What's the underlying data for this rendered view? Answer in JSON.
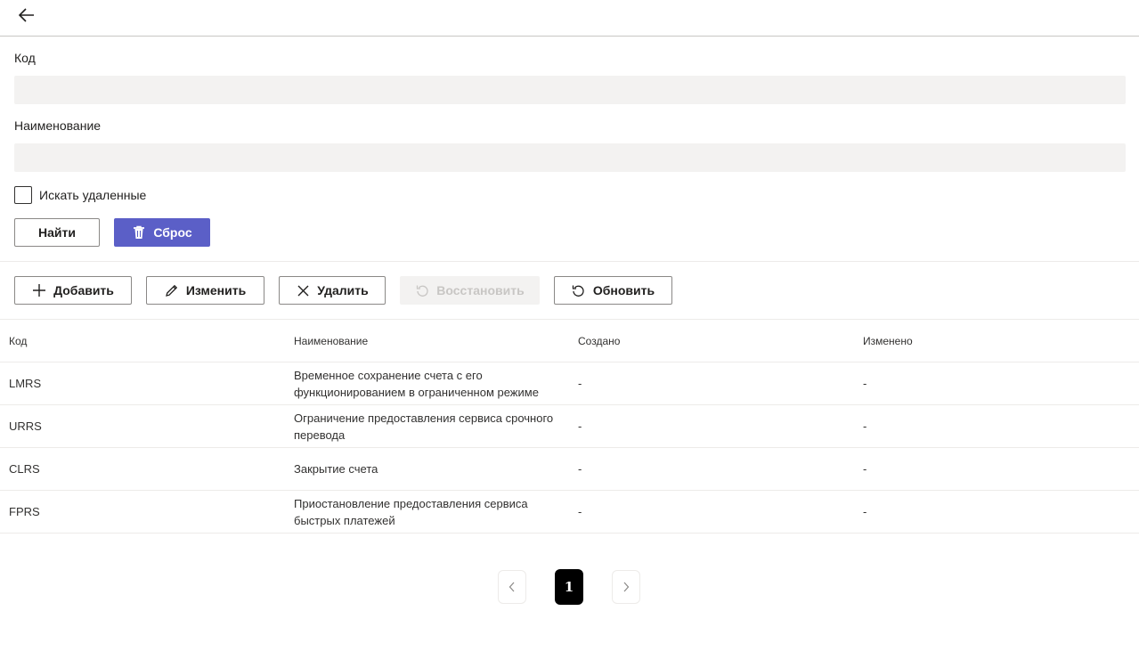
{
  "header": {
    "back_icon": "arrow-left-icon"
  },
  "filters": {
    "code_label": "Код",
    "code_value": "",
    "name_label": "Наименование",
    "name_value": "",
    "deleted_label": "Искать удаленные",
    "deleted_checked": false,
    "find_label": "Найти",
    "reset_label": "Сброс",
    "reset_icon": "trash-icon"
  },
  "toolbar": {
    "add_label": "Добавить",
    "edit_label": "Изменить",
    "delete_label": "Удалить",
    "restore_label": "Восстановить",
    "refresh_label": "Обновить"
  },
  "table": {
    "headers": [
      "Код",
      "Наименование",
      "Создано",
      "Изменено"
    ],
    "rows": [
      {
        "code": "LMRS",
        "name": "Временное сохранение счета с его функционированием в ограниченном режиме",
        "created": "-",
        "modified": "-"
      },
      {
        "code": "URRS",
        "name": "Ограничение предоставления сервиса срочного перевода",
        "created": "-",
        "modified": "-"
      },
      {
        "code": "CLRS",
        "name": "Закрытие счета",
        "created": "-",
        "modified": "-"
      },
      {
        "code": "FPRS",
        "name": "Приостановление предоставления сервиса быстрых платежей",
        "created": "-",
        "modified": "-"
      }
    ]
  },
  "pagination": {
    "current_page": "1"
  },
  "colors": {
    "primary": "#5b5fc7",
    "input_bg": "#f3f2f1",
    "border": "#8a8886"
  }
}
